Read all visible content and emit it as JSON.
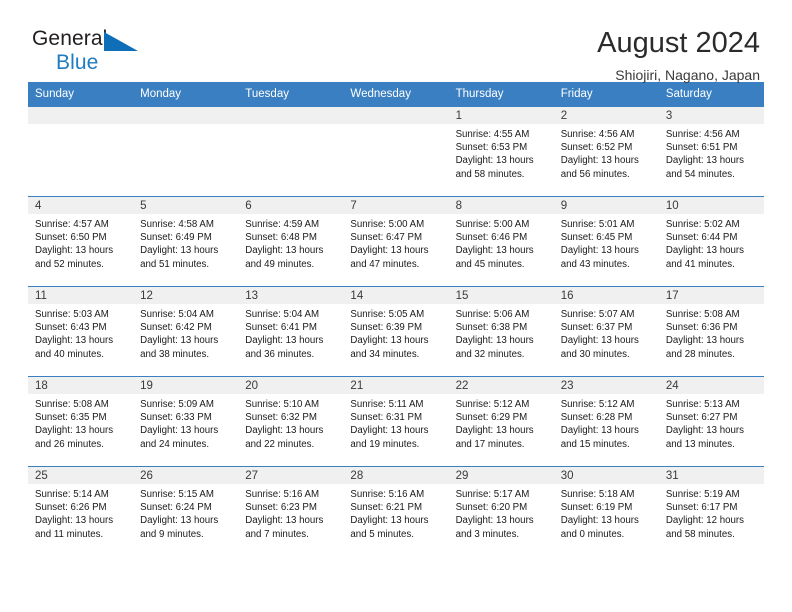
{
  "brand": {
    "name_part1": "General",
    "name_part2": "Blue",
    "logo_icon": "blue-triangle-icon"
  },
  "header": {
    "title": "August 2024",
    "subtitle": "Shiojiri, Nagano, Japan"
  },
  "colors": {
    "header_blue": "#3a7fc1",
    "brand_blue": "#1f7cc0",
    "daynum_band": "#f0f0f0",
    "text": "#1a1a1a"
  },
  "weekdays": [
    "Sunday",
    "Monday",
    "Tuesday",
    "Wednesday",
    "Thursday",
    "Friday",
    "Saturday"
  ],
  "weeks": [
    [
      {
        "day": "",
        "empty": true,
        "sunrise": "",
        "sunset": "",
        "daylight1": "",
        "daylight2": ""
      },
      {
        "day": "",
        "empty": true,
        "sunrise": "",
        "sunset": "",
        "daylight1": "",
        "daylight2": ""
      },
      {
        "day": "",
        "empty": true,
        "sunrise": "",
        "sunset": "",
        "daylight1": "",
        "daylight2": ""
      },
      {
        "day": "",
        "empty": true,
        "sunrise": "",
        "sunset": "",
        "daylight1": "",
        "daylight2": ""
      },
      {
        "day": "1",
        "empty": false,
        "sunrise": "Sunrise: 4:55 AM",
        "sunset": "Sunset: 6:53 PM",
        "daylight1": "Daylight: 13 hours",
        "daylight2": "and 58 minutes."
      },
      {
        "day": "2",
        "empty": false,
        "sunrise": "Sunrise: 4:56 AM",
        "sunset": "Sunset: 6:52 PM",
        "daylight1": "Daylight: 13 hours",
        "daylight2": "and 56 minutes."
      },
      {
        "day": "3",
        "empty": false,
        "sunrise": "Sunrise: 4:56 AM",
        "sunset": "Sunset: 6:51 PM",
        "daylight1": "Daylight: 13 hours",
        "daylight2": "and 54 minutes."
      }
    ],
    [
      {
        "day": "4",
        "empty": false,
        "sunrise": "Sunrise: 4:57 AM",
        "sunset": "Sunset: 6:50 PM",
        "daylight1": "Daylight: 13 hours",
        "daylight2": "and 52 minutes."
      },
      {
        "day": "5",
        "empty": false,
        "sunrise": "Sunrise: 4:58 AM",
        "sunset": "Sunset: 6:49 PM",
        "daylight1": "Daylight: 13 hours",
        "daylight2": "and 51 minutes."
      },
      {
        "day": "6",
        "empty": false,
        "sunrise": "Sunrise: 4:59 AM",
        "sunset": "Sunset: 6:48 PM",
        "daylight1": "Daylight: 13 hours",
        "daylight2": "and 49 minutes."
      },
      {
        "day": "7",
        "empty": false,
        "sunrise": "Sunrise: 5:00 AM",
        "sunset": "Sunset: 6:47 PM",
        "daylight1": "Daylight: 13 hours",
        "daylight2": "and 47 minutes."
      },
      {
        "day": "8",
        "empty": false,
        "sunrise": "Sunrise: 5:00 AM",
        "sunset": "Sunset: 6:46 PM",
        "daylight1": "Daylight: 13 hours",
        "daylight2": "and 45 minutes."
      },
      {
        "day": "9",
        "empty": false,
        "sunrise": "Sunrise: 5:01 AM",
        "sunset": "Sunset: 6:45 PM",
        "daylight1": "Daylight: 13 hours",
        "daylight2": "and 43 minutes."
      },
      {
        "day": "10",
        "empty": false,
        "sunrise": "Sunrise: 5:02 AM",
        "sunset": "Sunset: 6:44 PM",
        "daylight1": "Daylight: 13 hours",
        "daylight2": "and 41 minutes."
      }
    ],
    [
      {
        "day": "11",
        "empty": false,
        "sunrise": "Sunrise: 5:03 AM",
        "sunset": "Sunset: 6:43 PM",
        "daylight1": "Daylight: 13 hours",
        "daylight2": "and 40 minutes."
      },
      {
        "day": "12",
        "empty": false,
        "sunrise": "Sunrise: 5:04 AM",
        "sunset": "Sunset: 6:42 PM",
        "daylight1": "Daylight: 13 hours",
        "daylight2": "and 38 minutes."
      },
      {
        "day": "13",
        "empty": false,
        "sunrise": "Sunrise: 5:04 AM",
        "sunset": "Sunset: 6:41 PM",
        "daylight1": "Daylight: 13 hours",
        "daylight2": "and 36 minutes."
      },
      {
        "day": "14",
        "empty": false,
        "sunrise": "Sunrise: 5:05 AM",
        "sunset": "Sunset: 6:39 PM",
        "daylight1": "Daylight: 13 hours",
        "daylight2": "and 34 minutes."
      },
      {
        "day": "15",
        "empty": false,
        "sunrise": "Sunrise: 5:06 AM",
        "sunset": "Sunset: 6:38 PM",
        "daylight1": "Daylight: 13 hours",
        "daylight2": "and 32 minutes."
      },
      {
        "day": "16",
        "empty": false,
        "sunrise": "Sunrise: 5:07 AM",
        "sunset": "Sunset: 6:37 PM",
        "daylight1": "Daylight: 13 hours",
        "daylight2": "and 30 minutes."
      },
      {
        "day": "17",
        "empty": false,
        "sunrise": "Sunrise: 5:08 AM",
        "sunset": "Sunset: 6:36 PM",
        "daylight1": "Daylight: 13 hours",
        "daylight2": "and 28 minutes."
      }
    ],
    [
      {
        "day": "18",
        "empty": false,
        "sunrise": "Sunrise: 5:08 AM",
        "sunset": "Sunset: 6:35 PM",
        "daylight1": "Daylight: 13 hours",
        "daylight2": "and 26 minutes."
      },
      {
        "day": "19",
        "empty": false,
        "sunrise": "Sunrise: 5:09 AM",
        "sunset": "Sunset: 6:33 PM",
        "daylight1": "Daylight: 13 hours",
        "daylight2": "and 24 minutes."
      },
      {
        "day": "20",
        "empty": false,
        "sunrise": "Sunrise: 5:10 AM",
        "sunset": "Sunset: 6:32 PM",
        "daylight1": "Daylight: 13 hours",
        "daylight2": "and 22 minutes."
      },
      {
        "day": "21",
        "empty": false,
        "sunrise": "Sunrise: 5:11 AM",
        "sunset": "Sunset: 6:31 PM",
        "daylight1": "Daylight: 13 hours",
        "daylight2": "and 19 minutes."
      },
      {
        "day": "22",
        "empty": false,
        "sunrise": "Sunrise: 5:12 AM",
        "sunset": "Sunset: 6:29 PM",
        "daylight1": "Daylight: 13 hours",
        "daylight2": "and 17 minutes."
      },
      {
        "day": "23",
        "empty": false,
        "sunrise": "Sunrise: 5:12 AM",
        "sunset": "Sunset: 6:28 PM",
        "daylight1": "Daylight: 13 hours",
        "daylight2": "and 15 minutes."
      },
      {
        "day": "24",
        "empty": false,
        "sunrise": "Sunrise: 5:13 AM",
        "sunset": "Sunset: 6:27 PM",
        "daylight1": "Daylight: 13 hours",
        "daylight2": "and 13 minutes."
      }
    ],
    [
      {
        "day": "25",
        "empty": false,
        "sunrise": "Sunrise: 5:14 AM",
        "sunset": "Sunset: 6:26 PM",
        "daylight1": "Daylight: 13 hours",
        "daylight2": "and 11 minutes."
      },
      {
        "day": "26",
        "empty": false,
        "sunrise": "Sunrise: 5:15 AM",
        "sunset": "Sunset: 6:24 PM",
        "daylight1": "Daylight: 13 hours",
        "daylight2": "and 9 minutes."
      },
      {
        "day": "27",
        "empty": false,
        "sunrise": "Sunrise: 5:16 AM",
        "sunset": "Sunset: 6:23 PM",
        "daylight1": "Daylight: 13 hours",
        "daylight2": "and 7 minutes."
      },
      {
        "day": "28",
        "empty": false,
        "sunrise": "Sunrise: 5:16 AM",
        "sunset": "Sunset: 6:21 PM",
        "daylight1": "Daylight: 13 hours",
        "daylight2": "and 5 minutes."
      },
      {
        "day": "29",
        "empty": false,
        "sunrise": "Sunrise: 5:17 AM",
        "sunset": "Sunset: 6:20 PM",
        "daylight1": "Daylight: 13 hours",
        "daylight2": "and 3 minutes."
      },
      {
        "day": "30",
        "empty": false,
        "sunrise": "Sunrise: 5:18 AM",
        "sunset": "Sunset: 6:19 PM",
        "daylight1": "Daylight: 13 hours",
        "daylight2": "and 0 minutes."
      },
      {
        "day": "31",
        "empty": false,
        "sunrise": "Sunrise: 5:19 AM",
        "sunset": "Sunset: 6:17 PM",
        "daylight1": "Daylight: 12 hours",
        "daylight2": "and 58 minutes."
      }
    ]
  ]
}
